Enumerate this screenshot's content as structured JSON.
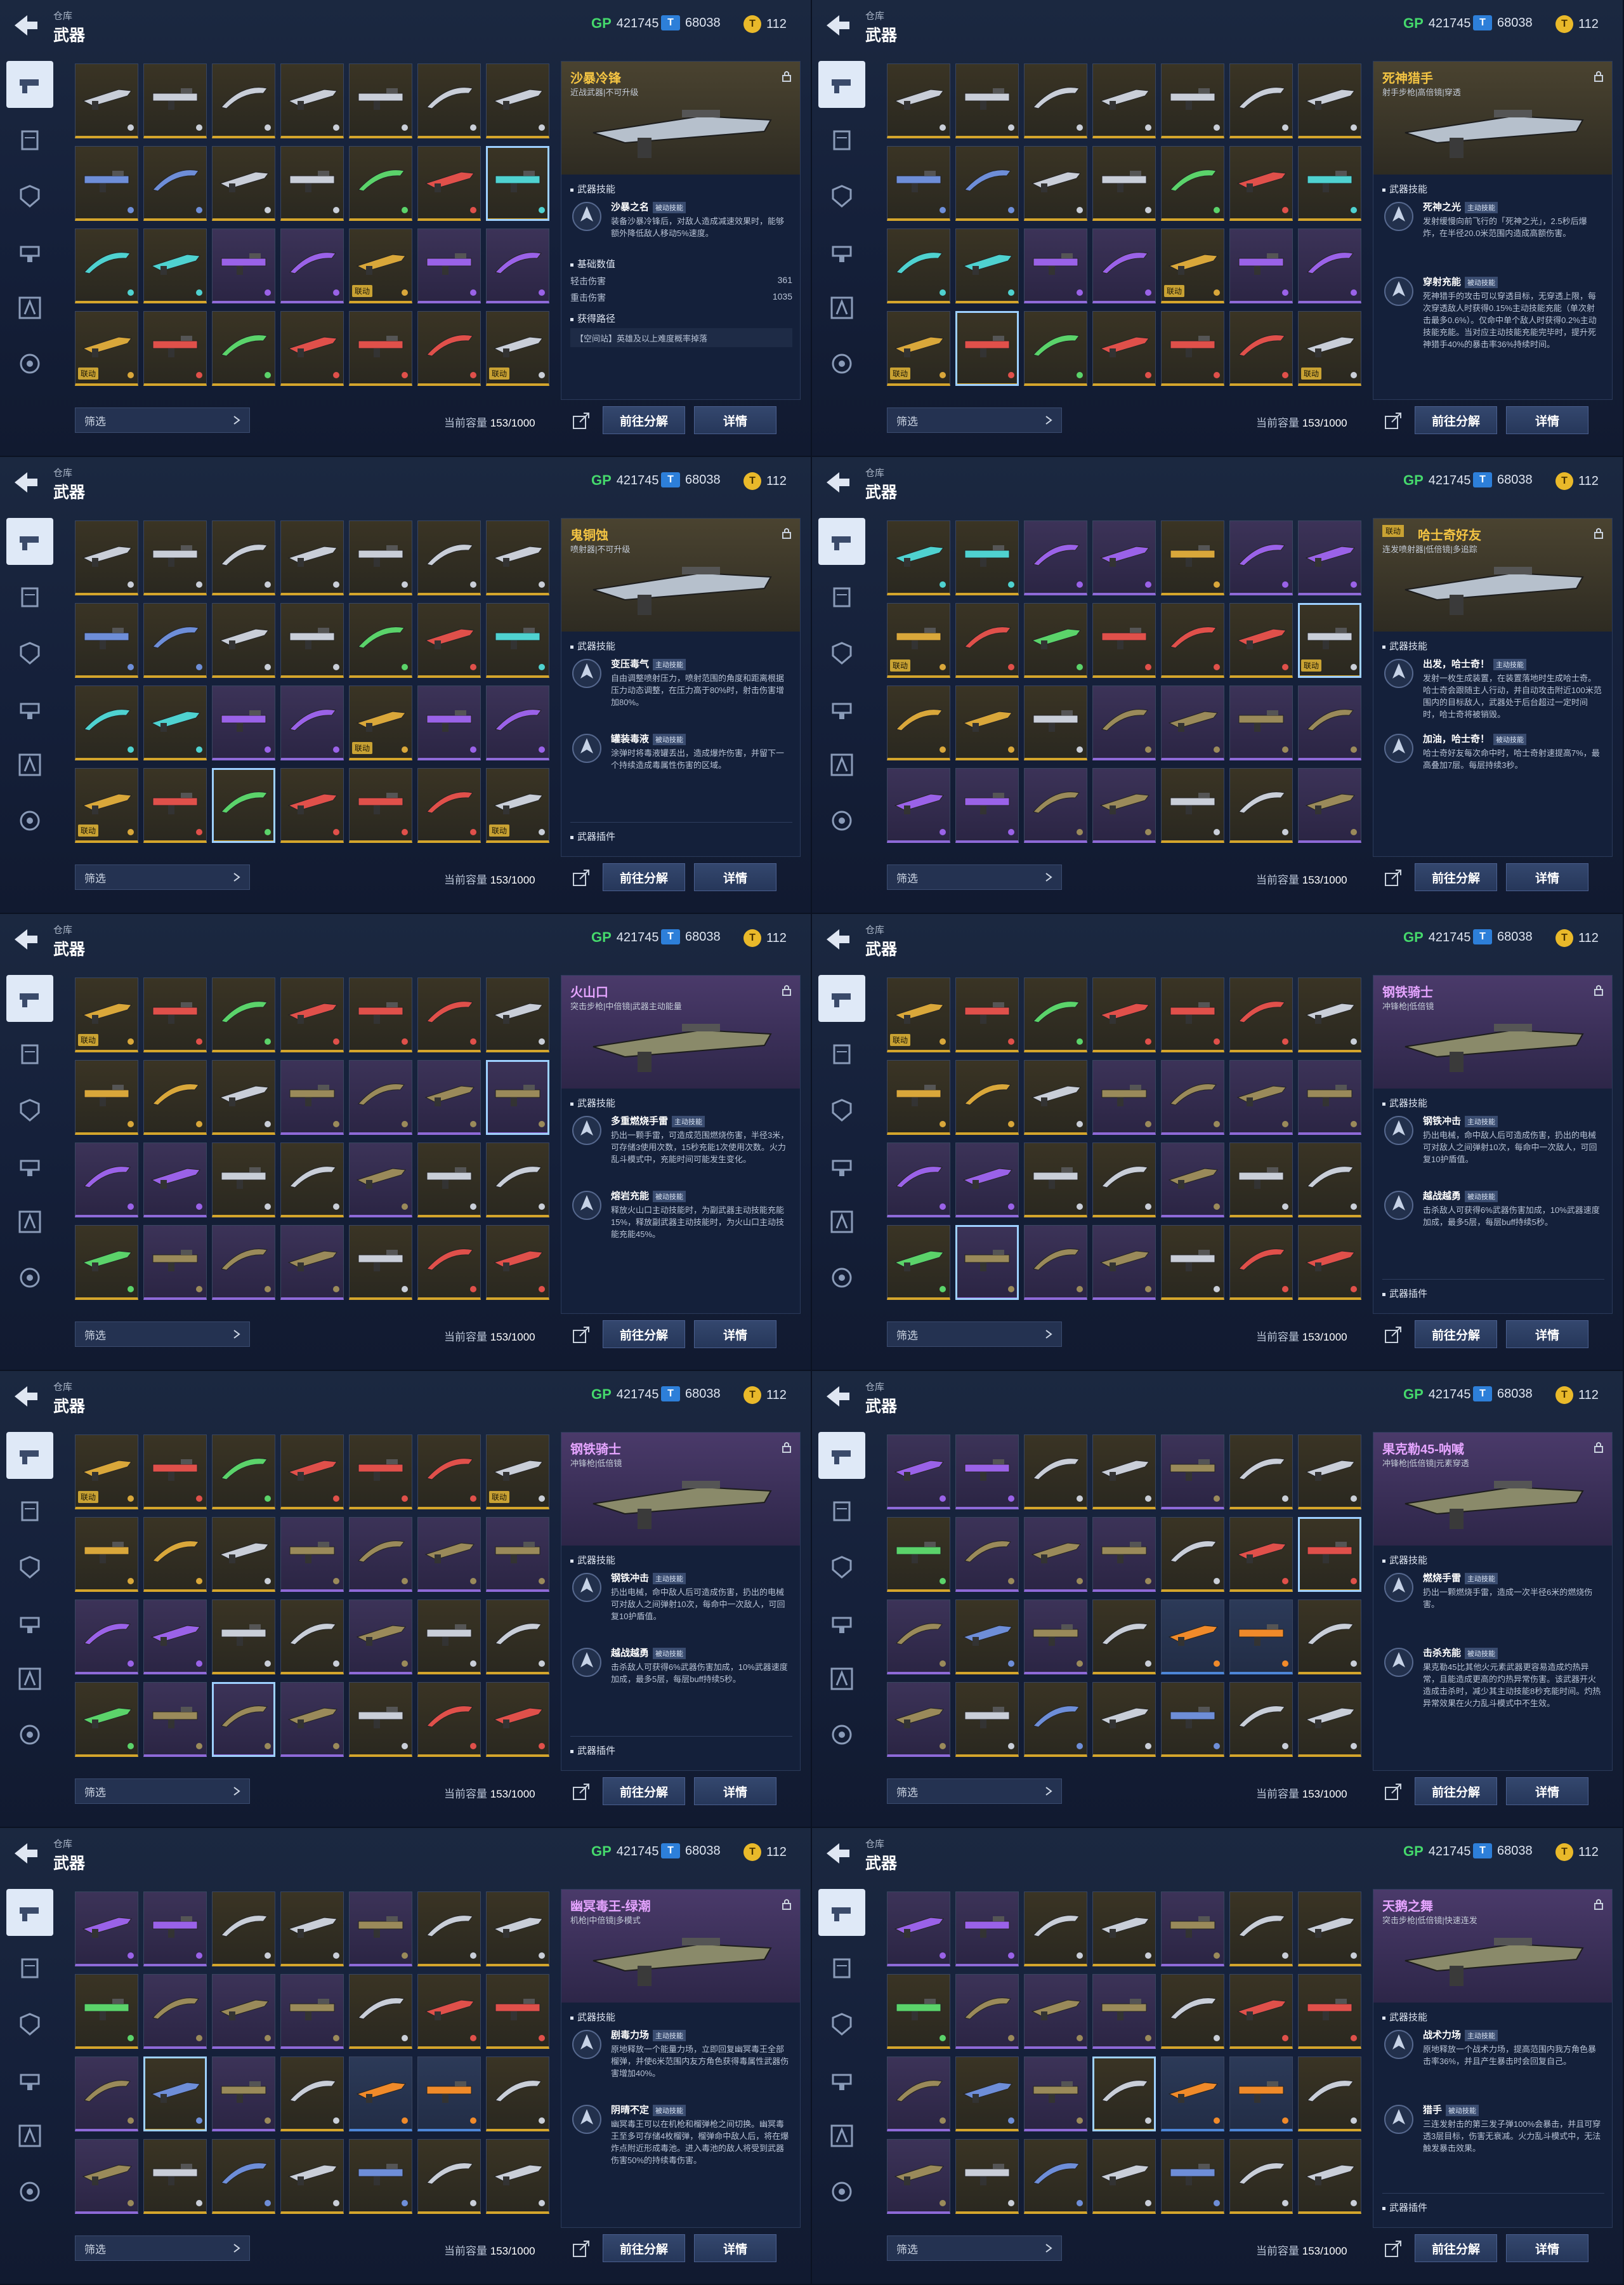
{
  "header": {
    "crumb": "仓库",
    "title": "武器"
  },
  "currency": {
    "gp": "421745",
    "tokens": "68038",
    "coins": "112"
  },
  "icons": [
    "pistol-icon",
    "module-icon",
    "shield-chip-icon",
    "turret-icon",
    "lambda-icon",
    "gear-badge-icon"
  ],
  "footer": {
    "filter_label": "筛选",
    "capacity_label": "当前容量",
    "capacity_value": "153/1000",
    "decompose_label": "前往分解",
    "detail_label": "详情"
  },
  "labels": {
    "linked": "联动",
    "weapon_skill": "武器技能",
    "base_values": "基础数值",
    "weapon_plugin": "武器插件",
    "source": "获得路径"
  },
  "panels": [
    {
      "name": "沙暴冷锋",
      "sub": "近战武器|不可升级",
      "rarity": "gold",
      "rows": [
        [
          "silver",
          "silver",
          "silver",
          "silver",
          "silver",
          "silver",
          "silver"
        ],
        [
          "blue",
          "blue",
          "silver",
          "silver",
          "green",
          "red",
          "cyan"
        ],
        [
          "cyan",
          "cyan",
          "purple",
          "purple",
          "gold",
          "purple",
          "purple"
        ],
        [
          "gold",
          "red",
          "green",
          "red",
          "red",
          "red",
          "silver"
        ]
      ],
      "sel": [
        1,
        6
      ],
      "tags": [
        [
          3,
          0
        ],
        [
          2,
          4
        ],
        [
          3,
          6
        ]
      ],
      "skills": [
        {
          "name": "沙暴之名",
          "badge": "被动技能",
          "desc": "装备沙暴冷锋后，对敌人造成减速效果时，能够额外降低敌人移动5%速度。"
        }
      ],
      "stats": [
        {
          "label": "轻击伤害",
          "value": "361"
        },
        {
          "label": "重击伤害",
          "value": "1035"
        }
      ],
      "source": "【空间站】英雄及以上难度概率掉落"
    },
    {
      "name": "死神猎手",
      "sub": "射手步枪|高倍镜|穿透",
      "rarity": "gold",
      "rows": [
        [
          "silver",
          "silver",
          "silver",
          "silver",
          "silver",
          "silver",
          "silver"
        ],
        [
          "blue",
          "blue",
          "silver",
          "silver",
          "green",
          "red",
          "cyan"
        ],
        [
          "cyan",
          "cyan",
          "purple",
          "purple",
          "gold",
          "purple",
          "purple"
        ],
        [
          "gold",
          "red",
          "green",
          "red",
          "red",
          "red",
          "silver"
        ]
      ],
      "sel": [
        3,
        1
      ],
      "tags": [
        [
          3,
          0
        ],
        [
          2,
          4
        ],
        [
          3,
          6
        ]
      ],
      "skills": [
        {
          "name": "死神之光",
          "badge": "主动技能",
          "desc": "发射缓慢向前飞行的「死神之光」，2.5秒后爆炸，在半径20.0米范围内造成高额伤害。"
        },
        {
          "name": "穿射充能",
          "badge": "被动技能",
          "desc": "死神猎手的攻击可以穿透目标，无穿透上限，每次穿透敌人时获得0.15%主动技能充能（单次射击最多0.6%）。仅命中单个敌人时获得0.2%主动技能充能。当对应主动技能充能完毕时，提升死神猎手40%的暴击率36%持续时间。"
        }
      ]
    },
    {
      "name": "鬼铜蚀",
      "sub": "喷射器|不可升级",
      "rarity": "gold",
      "rows": [
        [
          "silver",
          "silver",
          "silver",
          "silver",
          "silver",
          "silver",
          "silver"
        ],
        [
          "blue",
          "blue",
          "silver",
          "silver",
          "green",
          "red",
          "cyan"
        ],
        [
          "cyan",
          "cyan",
          "purple",
          "purple",
          "gold",
          "purple",
          "purple"
        ],
        [
          "gold",
          "red",
          "green",
          "red",
          "red",
          "red",
          "silver"
        ]
      ],
      "sel": [
        3,
        2
      ],
      "tags": [
        [
          3,
          0
        ],
        [
          2,
          4
        ],
        [
          3,
          6
        ]
      ],
      "skills": [
        {
          "name": "变压毒气",
          "badge": "主动技能",
          "desc": "自由调整喷射压力，喷射范围的角度和距离根据压力动态调整，在压力高于80%时，射击伤害增加80%。"
        },
        {
          "name": "罐装毒液",
          "badge": "被动技能",
          "desc": "涂弹时将毒液罐丢出，造成爆炸伤害，并留下一个持续造成毒属性伤害的区域。"
        }
      ],
      "plugin": true
    },
    {
      "name": "哈士奇好友",
      "sub": "连发喷射器|低倍镜|多追踪",
      "rarity": "gold",
      "linked": true,
      "rows": [
        [
          "cyan",
          "cyan",
          "purple",
          "purple",
          "gold",
          "purple",
          "purple"
        ],
        [
          "gold",
          "red",
          "green",
          "red",
          "red",
          "red",
          "silver"
        ],
        [
          "gold",
          "gold",
          "silver",
          "olive",
          "olive",
          "olive",
          "olive"
        ],
        [
          "purple",
          "purple",
          "olive",
          "olive",
          "silver",
          "silver",
          "olive"
        ]
      ],
      "sel": [
        1,
        6
      ],
      "tags": [
        [
          1,
          0
        ],
        [
          1,
          6
        ]
      ],
      "skills": [
        {
          "name": "出发，哈士奇！",
          "badge": "主动技能",
          "desc": "发射一枚生成装置，在装置落地时生成哈士奇。哈士奇会跟随主人行动，并自动攻击附近100米范围内的目标敌人，武器处于后台超过一定时间时，哈士奇将被销毁。"
        },
        {
          "name": "加油，哈士奇！",
          "badge": "被动技能",
          "desc": "哈士奇好友每次命中时，哈士奇射速提高7%，最高叠加7层。每层持续3秒。"
        }
      ]
    },
    {
      "name": "火山口",
      "sub": "突击步枪|中倍镜|武器主动能量",
      "rarity": "purple",
      "rows": [
        [
          "gold",
          "red",
          "green",
          "red",
          "red",
          "red",
          "silver"
        ],
        [
          "gold",
          "gold",
          "silver",
          "olive",
          "olive",
          "olive",
          "olive"
        ],
        [
          "purple",
          "purple",
          "silver",
          "silver",
          "olive",
          "silver",
          "silver"
        ],
        [
          "green",
          "olive",
          "olive",
          "olive",
          "silver",
          "red",
          "red"
        ]
      ],
      "sel": [
        1,
        6
      ],
      "tags": [
        [
          0,
          0
        ]
      ],
      "skills": [
        {
          "name": "多重燃烧手雷",
          "badge": "主动技能",
          "desc": "扔出一颗手雷，可造成范围燃烧伤害，半径3米，可存储3使用次数，15秒充能1次使用次数。火力乱斗模式中，充能时间可能发生变化。"
        },
        {
          "name": "熔岩充能",
          "badge": "被动技能",
          "desc": "释放火山口主动技能时，为副武器主动技能充能15%，释放副武器主动技能时，为火山口主动技能充能45%。"
        }
      ]
    },
    {
      "name": "钢铁骑士",
      "sub": "冲锋枪|低倍镜",
      "rarity": "purple",
      "rows": [
        [
          "gold",
          "red",
          "green",
          "red",
          "red",
          "red",
          "silver"
        ],
        [
          "gold",
          "gold",
          "silver",
          "olive",
          "olive",
          "olive",
          "olive"
        ],
        [
          "purple",
          "purple",
          "silver",
          "silver",
          "olive",
          "silver",
          "silver"
        ],
        [
          "green",
          "olive",
          "olive",
          "olive",
          "silver",
          "red",
          "red"
        ]
      ],
      "sel": [
        3,
        1
      ],
      "tags": [
        [
          0,
          0
        ]
      ],
      "skills": [
        {
          "name": "钢铁冲击",
          "badge": "主动技能",
          "desc": "扔出电械，命中敌人后可造成伤害，扔出的电械可对敌人之间弹射10次，每命中一次敌人，可回复10护盾值。"
        },
        {
          "name": "越战越勇",
          "badge": "被动技能",
          "desc": "击杀敌人可获得6%武器伤害加成，10%武器速度加成，最多5层，每层buff持续5秒。"
        }
      ],
      "plugin": true
    },
    {
      "name": "钢铁骑士",
      "sub": "冲锋枪|低倍镜",
      "rarity": "purple",
      "rows": [
        [
          "gold",
          "red",
          "green",
          "red",
          "red",
          "red",
          "silver"
        ],
        [
          "gold",
          "gold",
          "silver",
          "olive",
          "olive",
          "olive",
          "olive"
        ],
        [
          "purple",
          "purple",
          "silver",
          "silver",
          "olive",
          "silver",
          "silver"
        ],
        [
          "green",
          "olive",
          "olive",
          "olive",
          "silver",
          "red",
          "red"
        ]
      ],
      "sel": [
        3,
        2
      ],
      "tags": [
        [
          0,
          0
        ],
        [
          0,
          6
        ]
      ],
      "skills": [
        {
          "name": "钢铁冲击",
          "badge": "主动技能",
          "desc": "扔出电械，命中敌人后可造成伤害，扔出的电械可对敌人之间弹射10次，每命中一次敌人，可回复10护盾值。"
        },
        {
          "name": "越战越勇",
          "badge": "被动技能",
          "desc": "击杀敌人可获得6%武器伤害加成，10%武器速度加成，最多5层，每层buff持续5秒。"
        }
      ],
      "plugin": true
    },
    {
      "name": "果克勒45-呐喊",
      "sub": "冲锋枪|低倍镜|元素穿透",
      "rarity": "purple",
      "rows": [
        [
          "purple",
          "purple",
          "silver",
          "silver",
          "olive",
          "silver",
          "silver"
        ],
        [
          "green",
          "olive",
          "olive",
          "olive",
          "silver",
          "red",
          "red"
        ],
        [
          "olive",
          "blue",
          "olive",
          "silver",
          "orange",
          "orange",
          "silver"
        ],
        [
          "olive",
          "silver",
          "blue",
          "silver",
          "blue",
          "silver",
          "silver"
        ]
      ],
      "sel": [
        1,
        6
      ],
      "tags": [],
      "skills": [
        {
          "name": "燃烧手雷",
          "badge": "主动技能",
          "desc": "扔出一颗燃烧手雷，造成一次半径6米的燃烧伤害。"
        },
        {
          "name": "击杀充能",
          "badge": "被动技能",
          "desc": "果克勒45比其他火元素武器更容易造成灼热异常，且能造成更高的灼热异常伤害。该武器开火造成击杀时，减少其主动技能8秒充能时间。灼热异常效果在火力乱斗模式中不生效。"
        }
      ]
    },
    {
      "name": "幽冥毒王-绿潮",
      "sub": "机枪|中倍镜|多模式",
      "rarity": "purple",
      "rows": [
        [
          "purple",
          "purple",
          "silver",
          "silver",
          "olive",
          "silver",
          "silver"
        ],
        [
          "green",
          "olive",
          "olive",
          "olive",
          "silver",
          "red",
          "red"
        ],
        [
          "olive",
          "blue",
          "olive",
          "silver",
          "orange",
          "orange",
          "silver"
        ],
        [
          "olive",
          "silver",
          "blue",
          "silver",
          "blue",
          "silver",
          "silver"
        ]
      ],
      "sel": [
        2,
        1
      ],
      "tags": [],
      "skills": [
        {
          "name": "剧毒力场",
          "badge": "主动技能",
          "desc": "原地释放一个能量力场，立即回复幽冥毒王全部榴弹，并使6米范围内友方角色获得毒属性武器伤害增加40%。"
        },
        {
          "name": "阴晴不定",
          "badge": "被动技能",
          "desc": "幽冥毒王可以在机枪和榴弹枪之间切换。幽冥毒王至多可存储4枚榴弹，榴弹命中敌人后，将在爆炸点附近形成毒池。进入毒池的敌人将受到武器伤害50%的持续毒伤害。"
        }
      ]
    },
    {
      "name": "天鹅之舞",
      "sub": "突击步枪|低倍镜|快速连发",
      "rarity": "purple",
      "rows": [
        [
          "purple",
          "purple",
          "silver",
          "silver",
          "olive",
          "silver",
          "silver"
        ],
        [
          "green",
          "olive",
          "olive",
          "olive",
          "silver",
          "red",
          "red"
        ],
        [
          "olive",
          "blue",
          "olive",
          "silver",
          "orange",
          "orange",
          "silver"
        ],
        [
          "olive",
          "silver",
          "blue",
          "silver",
          "blue",
          "silver",
          "silver"
        ]
      ],
      "sel": [
        2,
        3
      ],
      "tags": [],
      "skills": [
        {
          "name": "战术力场",
          "badge": "主动技能",
          "desc": "原地释放一个战术力场，提高范围内我方角色暴击率36%，并且产生暴击时会回复自己。"
        },
        {
          "name": "猎手",
          "badge": "被动技能",
          "desc": "三连发射击的第三发子弹100%会暴击，并且可穿透3层目标，伤害无衰减。火力乱斗模式中，无法触发暴击效果。"
        }
      ],
      "plugin": true
    }
  ]
}
